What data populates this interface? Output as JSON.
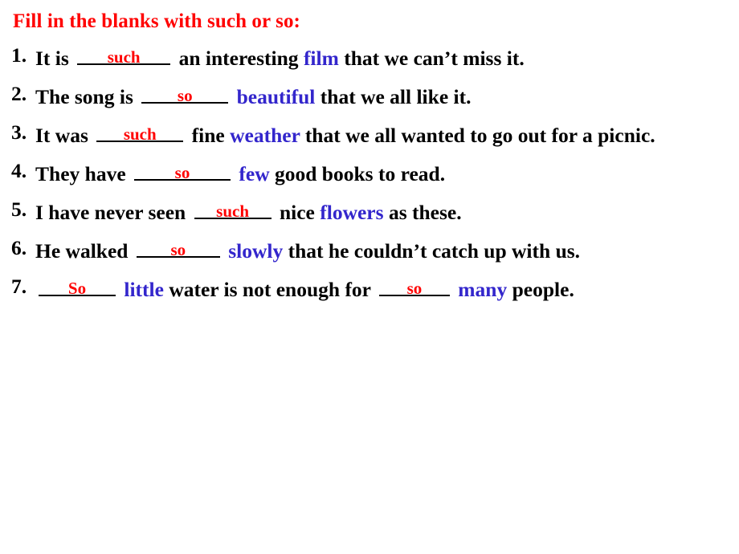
{
  "slide": {
    "title": "Fill in the blanks with such or so:",
    "accent_red": "#ff0000",
    "accent_blue": "#3326cc",
    "text_color": "#000000",
    "background": "#ffffff"
  },
  "questions": [
    {
      "number": "1.",
      "pre": "It is ",
      "answer": "such",
      "mid": " an interesting ",
      "keyword": "film",
      "post": " that we can’t miss it.",
      "tail": ""
    },
    {
      "number": "2.",
      "pre": "The song is ",
      "answer": "so",
      "mid": " ",
      "keyword": "beautiful",
      "post": " that we all like it.",
      "tail": ""
    },
    {
      "number": "3.",
      "pre": "It was ",
      "answer": "such",
      "mid": " fine ",
      "keyword": "weather",
      "post": " that we all wanted to go",
      "tail": "out for a picnic."
    },
    {
      "number": "4.",
      "pre": "They have ",
      "answer": "so",
      "mid": " ",
      "keyword": "few",
      "post": " good books to read.",
      "tail": ""
    },
    {
      "number": "5.",
      "pre": "I have never seen ",
      "answer": "such",
      "mid": " nice ",
      "keyword": "flowers",
      "post": " as these.",
      "tail": ""
    },
    {
      "number": "6.",
      "pre": "He walked ",
      "answer": "so",
      "mid": " ",
      "keyword": "slowly",
      "post": " that he couldn’t catch up",
      "tail": "with us."
    },
    {
      "number": "7.",
      "pre": "",
      "answer": "So",
      "mid": " ",
      "keyword": "little",
      "post": " water is not enough for ",
      "answer2": "so",
      "mid2": " ",
      "keyword2": "many",
      "tail": "people."
    }
  ]
}
